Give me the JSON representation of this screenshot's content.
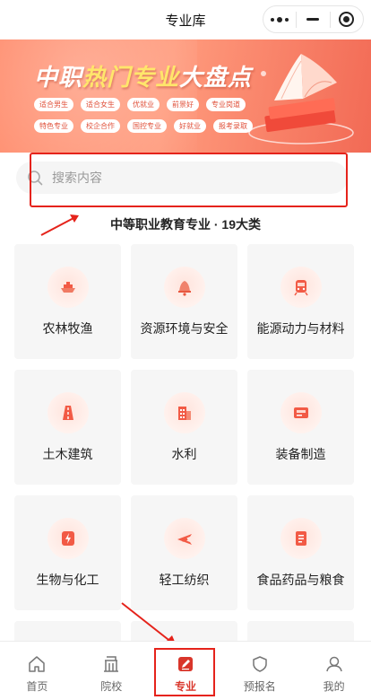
{
  "nav": {
    "title": "专业库"
  },
  "banner": {
    "title_part1": "中职",
    "title_highlight": "热门专业",
    "title_part2": "大盘点",
    "tags_row1": [
      "适合男生",
      "适合女生",
      "优就业",
      "前景好",
      "专业岗道"
    ],
    "tags_row2": [
      "特色专业",
      "校企合作",
      "国控专业",
      "好就业",
      "报考录取"
    ]
  },
  "search": {
    "placeholder": "搜索内容"
  },
  "section": {
    "title": "中等职业教育专业 · 19大类"
  },
  "categories": [
    {
      "label": "农林牧渔",
      "icon": "boat-icon"
    },
    {
      "label": "资源环境与安全",
      "icon": "bell-icon"
    },
    {
      "label": "能源动力与材料",
      "icon": "train-icon"
    },
    {
      "label": "土木建筑",
      "icon": "road-icon"
    },
    {
      "label": "水利",
      "icon": "building-icon"
    },
    {
      "label": "装备制造",
      "icon": "card-icon"
    },
    {
      "label": "生物与化工",
      "icon": "lightning-icon"
    },
    {
      "label": "轻工纺织",
      "icon": "plane-icon"
    },
    {
      "label": "食品药品与粮食",
      "icon": "document-icon"
    }
  ],
  "tabbar": {
    "items": [
      {
        "label": "首页",
        "icon": "home-icon"
      },
      {
        "label": "院校",
        "icon": "school-icon"
      },
      {
        "label": "专业",
        "icon": "edit-icon",
        "active": true
      },
      {
        "label": "预报名",
        "icon": "shield-icon"
      },
      {
        "label": "我的",
        "icon": "user-icon"
      }
    ]
  },
  "colors": {
    "accent": "#d9362b",
    "banner": "#ff8a6a",
    "highlight_box": "#e5231b"
  }
}
